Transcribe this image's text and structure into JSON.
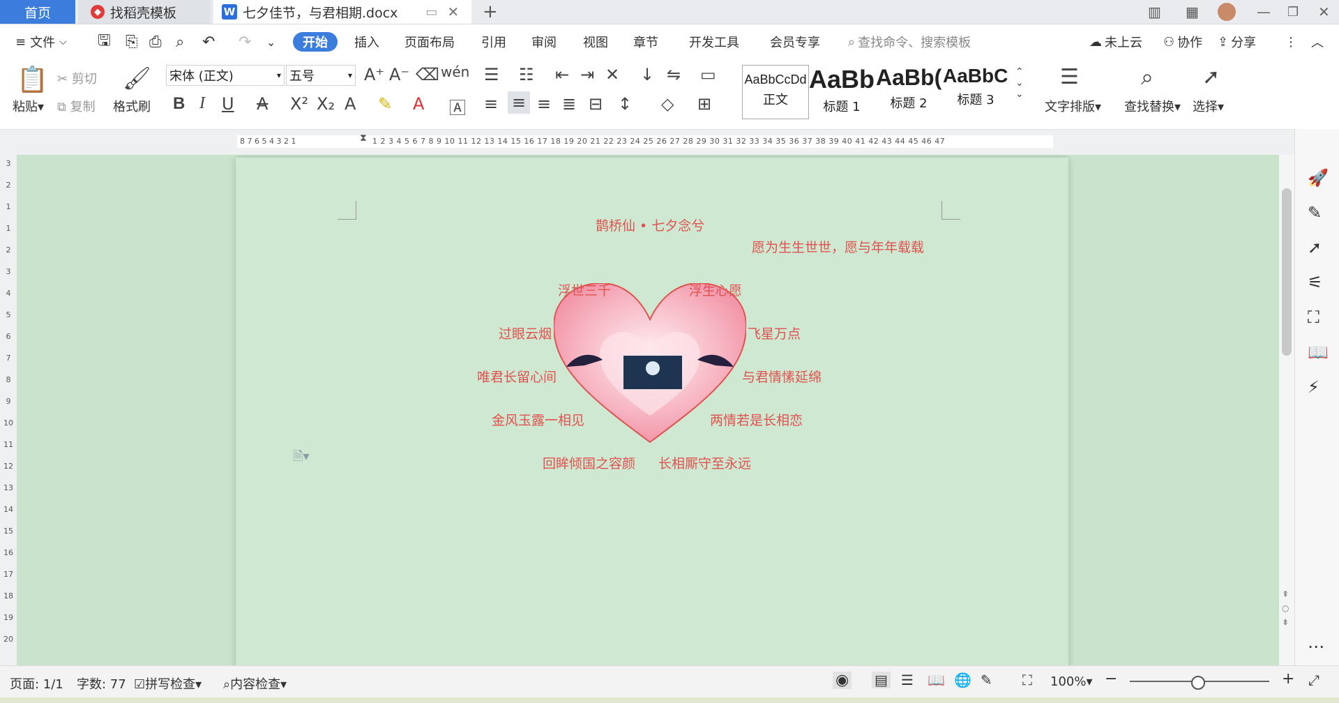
{
  "tabs": {
    "home": "首页",
    "template": "找稻壳模板",
    "document": "七夕佳节，与君相期.docx"
  },
  "menu": {
    "file": "文件",
    "items": [
      "开始",
      "插入",
      "页面布局",
      "引用",
      "审阅",
      "视图",
      "章节",
      "开发工具",
      "会员专享"
    ],
    "search_placeholder": "查找命令、搜索模板",
    "cloud": "未上云",
    "collab": "协作",
    "share": "分享"
  },
  "ribbon": {
    "paste": "粘贴",
    "cut": "剪切",
    "copy": "复制",
    "format_painter": "格式刷",
    "font_name": "宋体 (正文)",
    "font_size": "五号",
    "styles": [
      {
        "preview": "AaBbCcDd",
        "name": "正文"
      },
      {
        "preview": "AaBb",
        "name": "标题 1"
      },
      {
        "preview": "AaBb(",
        "name": "标题 2"
      },
      {
        "preview": "AaBbC(",
        "name": "标题 3"
      }
    ],
    "text_layout": "文字排版",
    "find_replace": "查找替换",
    "select": "选择"
  },
  "ruler": {
    "left_ticks": "8 7 6 5 4 3 2 1",
    "right_ticks": "1 2 3 4 5 6 7 8 9 10 11 12 13 14 15 16 17 18 19 20 21 22 23 24 25 26 27 28 29 30 31 32 33 34 35 36 37 38 39 40 41 42 43 44 45 46 47",
    "vertical_ticks": [
      "3",
      "2",
      "1",
      "1",
      "2",
      "3",
      "4",
      "5",
      "6",
      "7",
      "8",
      "9",
      "10",
      "11",
      "12",
      "13",
      "14",
      "15",
      "16",
      "17",
      "18",
      "19",
      "20"
    ]
  },
  "poem": {
    "title": "鹊桥仙 • 七夕念兮",
    "line_top_right": "愿为生生世世，愿与年年载载",
    "left": [
      "浮世三千",
      "过眼云烟",
      "唯君长留心间",
      "金风玉露一相见",
      "回眸倾国之容颜"
    ],
    "right": [
      "浮生心愿",
      "飞星万点",
      "与君情愫延绵",
      "两情若是长相恋",
      "长相厮守至永远"
    ]
  },
  "status": {
    "page": "页面: 1/1",
    "words": "字数: 77",
    "spell": "拼写检查",
    "content": "内容检查",
    "zoom": "100%"
  },
  "colors": {
    "accent": "#3b7ddd",
    "page_bg": "#cfe8d1",
    "poem_text": "#e0524f",
    "heart": "#f7b7c3"
  }
}
